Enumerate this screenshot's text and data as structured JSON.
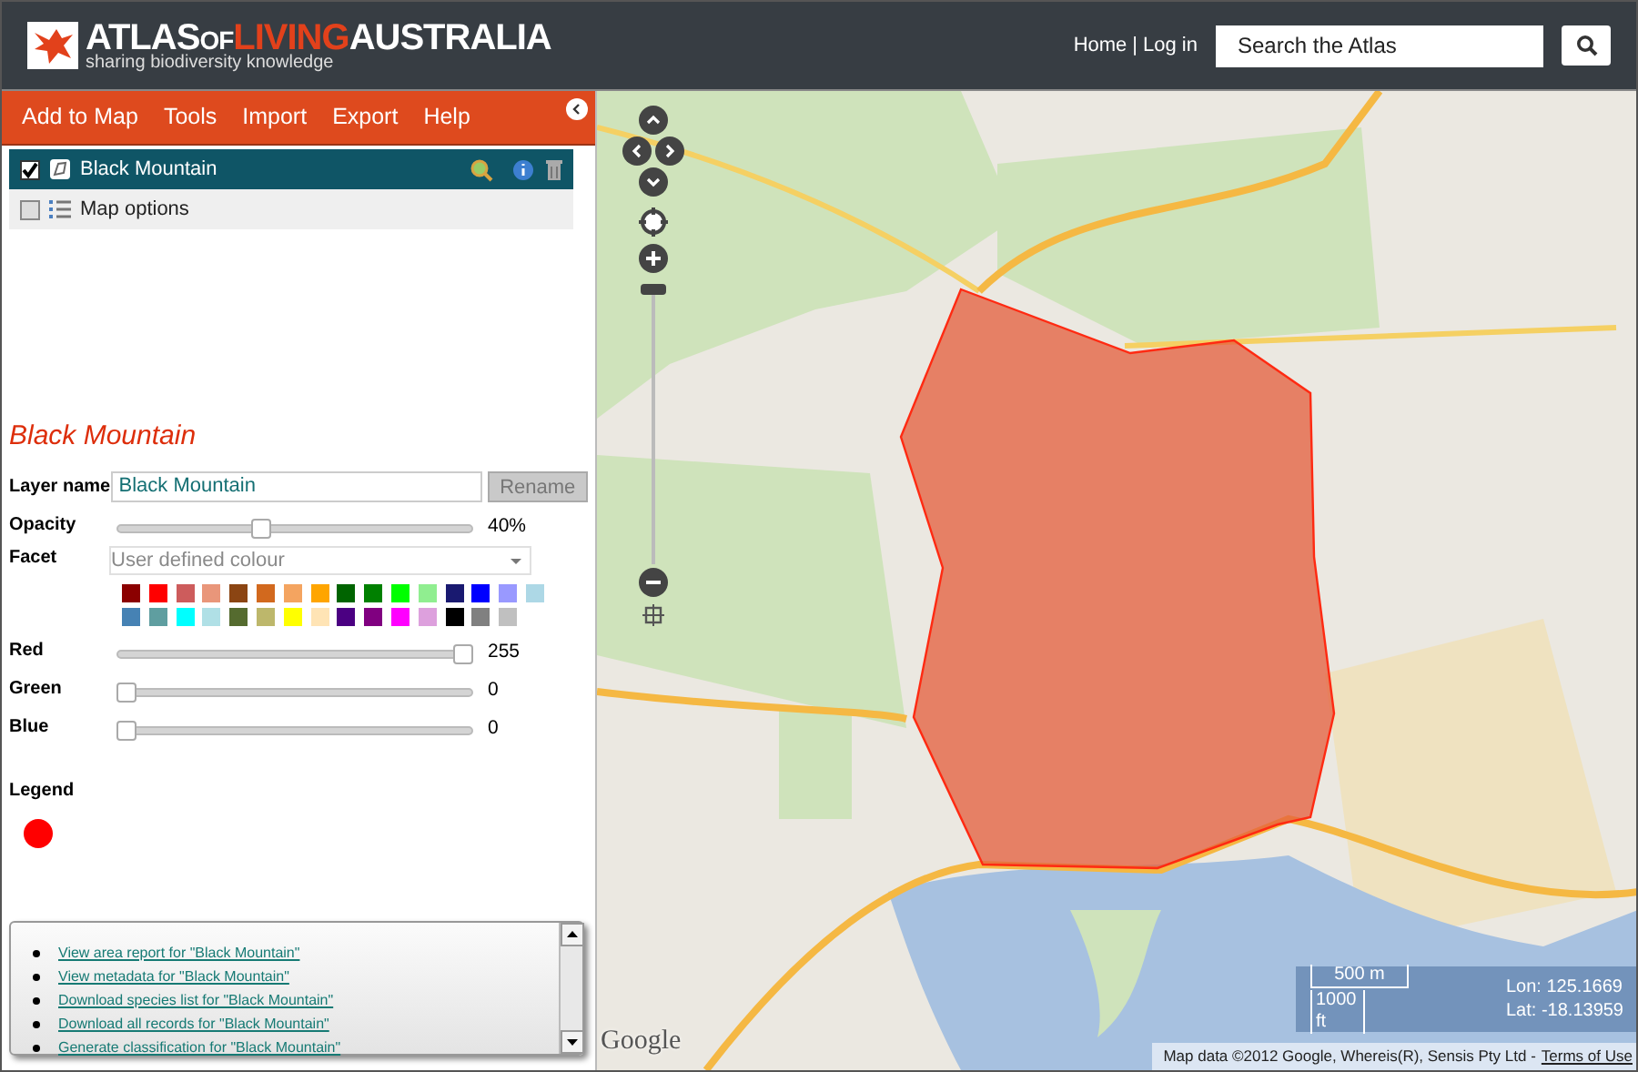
{
  "header": {
    "logo": [
      {
        "text": "ATLAS",
        "kind": "plain"
      },
      {
        "text": "OF",
        "kind": "small"
      },
      {
        "text": "LIVING",
        "kind": "accent"
      },
      {
        "text": "AUSTRALIA",
        "kind": "plain"
      }
    ],
    "tagline": "sharing biodiversity knowledge",
    "links": [
      "Home",
      "Log in"
    ],
    "separator": "|",
    "search": {
      "placeholder": "Search the Atlas"
    }
  },
  "menu": [
    "Add to Map",
    "Tools",
    "Import",
    "Export",
    "Help"
  ],
  "layers": [
    {
      "label": "Black Mountain",
      "kind": "area",
      "checked": true,
      "selected": true
    },
    {
      "label": "Map options",
      "kind": "options",
      "checked": false,
      "selected": false
    }
  ],
  "detail": {
    "title": "Black Mountain",
    "layer_name": {
      "label": "Layer name",
      "value": "Black Mountain"
    },
    "rename": {
      "label": "Rename",
      "disabled": true
    },
    "opacity": {
      "label": "Opacity",
      "level": 0.4,
      "reading": "40%"
    },
    "facet": {
      "label": "Facet",
      "placeholder": "User defined colour",
      "disabled": true
    },
    "palette": [
      {
        "color": "#8b0000"
      },
      {
        "color": "#ff0000"
      },
      {
        "color": "#cd5c5c"
      },
      {
        "color": "#e9967a"
      },
      {
        "color": "#8b4513"
      },
      {
        "color": "#d2691e"
      },
      {
        "color": "#f4a460"
      },
      {
        "color": "#ffa500"
      },
      {
        "color": "#006400"
      },
      {
        "color": "#008000"
      },
      {
        "color": "#00ff00"
      },
      {
        "color": "#90ee90"
      },
      {
        "color": "#191970"
      },
      {
        "color": "#0000ff"
      },
      {
        "color": "#9999ff"
      },
      {
        "color": "#add8e6"
      },
      {
        "color": "#4682b4"
      },
      {
        "color": "#5f9ea0"
      },
      {
        "color": "#00ffff"
      },
      {
        "color": "#b0e0e6"
      },
      {
        "color": "#556b2f"
      },
      {
        "color": "#bdb76b"
      },
      {
        "color": "#ffff00"
      },
      {
        "color": "#ffe4b5"
      },
      {
        "color": "#4b0082"
      },
      {
        "color": "#800080"
      },
      {
        "color": "#ff00ff"
      },
      {
        "color": "#dda0dd"
      },
      {
        "color": "#000000"
      },
      {
        "color": "#808080"
      },
      {
        "color": "#c0c0c0"
      }
    ],
    "channels": [
      {
        "label": "Red",
        "level": 1,
        "reading": "255"
      },
      {
        "label": "Green",
        "level": 0,
        "reading": "0"
      },
      {
        "label": "Blue",
        "level": 0,
        "reading": "0"
      }
    ],
    "legend": {
      "label": "Legend",
      "color": "#ff0000"
    }
  },
  "links": [
    "View area report for \"Black Mountain\"",
    "View metadata for \"Black Mountain\"",
    "Download species list for \"Black Mountain\"",
    "Download all records for \"Black Mountain\"",
    "Generate classification for \"Black Mountain\""
  ],
  "map": {
    "zoom": {
      "level": 1
    },
    "scale": [
      "500 m",
      "1000 ft"
    ],
    "lon": "Lon: 125.1669",
    "lat": "Lat: -18.13959",
    "google": "Google",
    "attribution": "Map data ©2012 Google, Whereis(R), Sensis Pty Ltd -",
    "terms": "Terms of Use"
  }
}
